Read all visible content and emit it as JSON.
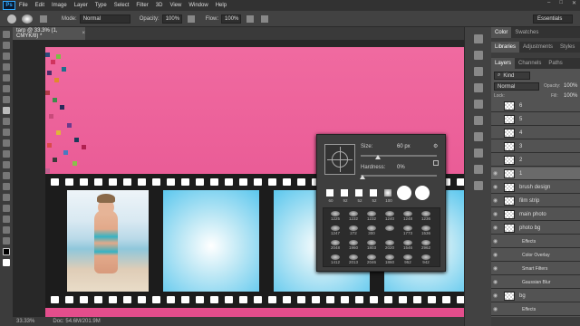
{
  "menu": {
    "logo": "Ps",
    "items": [
      "File",
      "Edit",
      "Image",
      "Layer",
      "Type",
      "Select",
      "Filter",
      "3D",
      "View",
      "Window",
      "Help"
    ],
    "window_controls": [
      "–",
      "□",
      "✕"
    ]
  },
  "options": {
    "mode_label": "Mode:",
    "mode_value": "Normal",
    "opacity_label": "Opacity:",
    "opacity_value": "100%",
    "flow_label": "Flow:",
    "flow_value": "100%",
    "workspace": "Essentials"
  },
  "document": {
    "tab_title": "tarp @ 33.3% (1, CMYK/8) *",
    "status_zoom": "33.33%",
    "status_doc": "Doc: 54.6M/201.9M"
  },
  "brush_panel": {
    "size_label": "Size:",
    "size_value": "60 px",
    "hardness_label": "Hardness:",
    "hardness_value": "0%",
    "preset_top_row": [
      "60",
      "92",
      "52",
      "52",
      "100"
    ],
    "preset_rows": [
      [
        "1225",
        "1232",
        "1232",
        "1240",
        "1248",
        "1236"
      ],
      [
        "1247",
        "272",
        "300",
        "",
        "1773",
        "1536"
      ],
      [
        "2048",
        "1960",
        "1803",
        "2020",
        "1546",
        "2962"
      ],
      [
        "1412",
        "2013",
        "2046",
        "1860",
        "952",
        "942"
      ]
    ]
  },
  "right_panel": {
    "tabs_row1": [
      "Color",
      "Swatches"
    ],
    "tabs_row2": [
      "Libraries",
      "Adjustments",
      "Styles"
    ],
    "tabs_row3": [
      "Layers",
      "Channels",
      "Paths"
    ],
    "kind_label": "Kind",
    "blend_mode": "Normal",
    "opacity_label": "Opacity:",
    "opacity_value": "100%",
    "lock_label": "Lock:",
    "fill_label": "Fill:",
    "fill_value": "100%",
    "layers": [
      {
        "name": "6",
        "visible": false
      },
      {
        "name": "5",
        "visible": false
      },
      {
        "name": "4",
        "visible": false
      },
      {
        "name": "3",
        "visible": false
      },
      {
        "name": "2",
        "visible": false
      },
      {
        "name": "1",
        "visible": true,
        "selected": true
      },
      {
        "name": "brush design",
        "visible": true
      },
      {
        "name": "film strip",
        "visible": true
      },
      {
        "name": "main photo",
        "visible": true
      },
      {
        "name": "photo bg",
        "visible": true
      },
      {
        "name": "Effects",
        "visible": true,
        "sub": true
      },
      {
        "name": "Color Overlay",
        "visible": true,
        "sub": true
      },
      {
        "name": "Smart Filters",
        "visible": true,
        "sub": true
      },
      {
        "name": "Gaussian Blur",
        "visible": true,
        "sub": true
      },
      {
        "name": "bg",
        "visible": true
      },
      {
        "name": "Effects",
        "visible": true,
        "sub": true
      }
    ]
  },
  "colors": {
    "pink": "#e8588f",
    "panel_bg": "#3d3d3d",
    "selected_layer": "#6a6a6a"
  }
}
